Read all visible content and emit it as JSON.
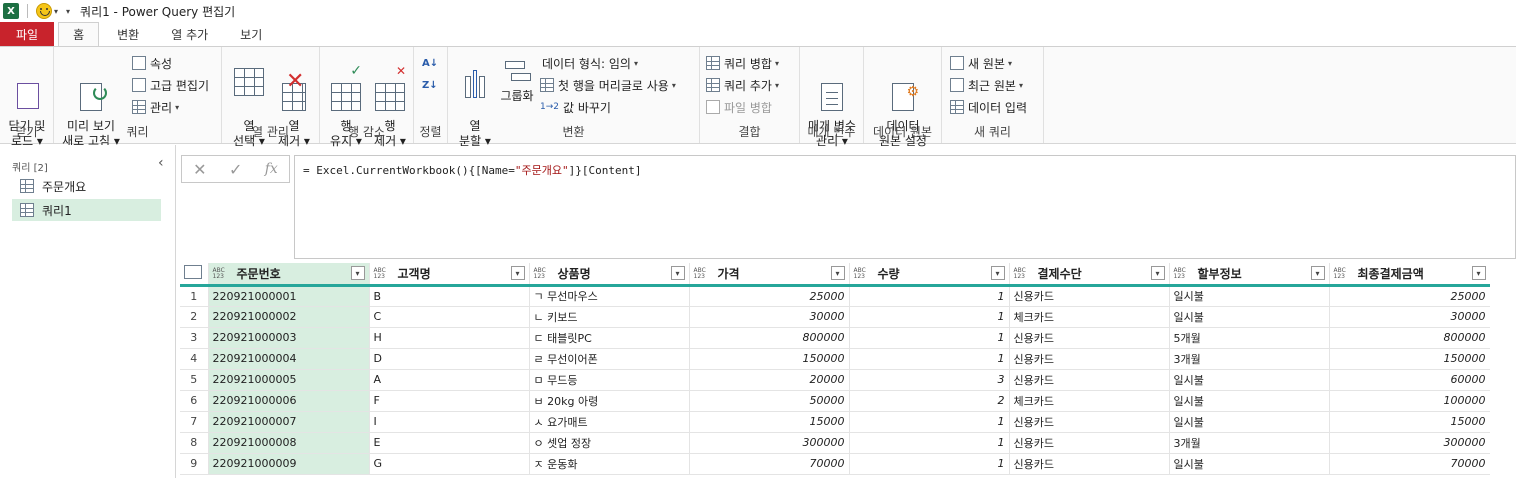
{
  "titlebar": {
    "app_icon": "X",
    "title": "쿼리1 - Power Query 편집기"
  },
  "tabs": [
    "파일",
    "홈",
    "변환",
    "열 추가",
    "보기"
  ],
  "ribbon": {
    "close": {
      "btn": "닫기 및\n로드 ▾",
      "group": "닫기"
    },
    "query": {
      "refresh": "미리 보기\n새로 고침 ▾",
      "properties": "속성",
      "advanced_editor": "고급 편집기",
      "manage": "관리",
      "group": "쿼리"
    },
    "columns": {
      "choose": "열\n선택 ▾",
      "remove": "열\n제거 ▾",
      "group": "열 관리"
    },
    "rows": {
      "keep": "행\n유지 ▾",
      "remove": "행\n제거 ▾",
      "group": "행 감소"
    },
    "sort": {
      "group": "정렬"
    },
    "transform": {
      "split": "열\n분할 ▾",
      "groupby": "그룹화",
      "data_type": "데이터 형식: 임의",
      "first_row_header": "첫 행을 머리글로 사용",
      "replace_values": "값 바꾸기",
      "group": "변환"
    },
    "combine": {
      "merge": "쿼리 병합",
      "append": "쿼리 추가",
      "combine_files": "파일 병합",
      "group": "결합"
    },
    "params": {
      "manage": "매개 변수\n관리 ▾",
      "group": "매개 변수"
    },
    "datasource": {
      "settings": "데이터\n원본 설정",
      "group": "데이터 원본"
    },
    "newquery": {
      "new_source": "새 원본",
      "recent_sources": "최근 원본",
      "enter_data": "데이터 입력",
      "group": "새 쿼리"
    }
  },
  "queries_pane": {
    "title": "쿼리 [2]",
    "items": [
      "주문개요",
      "쿼리1"
    ]
  },
  "formula": {
    "prefix": "= Excel.CurrentWorkbook(){[Name=",
    "string": "\"주문개요\"",
    "suffix": "]}[Content]"
  },
  "table": {
    "columns": [
      "주문번호",
      "고객명",
      "상품명",
      "가격",
      "수량",
      "결제수단",
      "할부정보",
      "최종결제금액"
    ],
    "rows": [
      [
        "1",
        "220921000001",
        "B",
        "ㄱ 무선마우스",
        "25000",
        "1",
        "신용카드",
        "일시불",
        "25000"
      ],
      [
        "2",
        "220921000002",
        "C",
        "ㄴ 키보드",
        "30000",
        "1",
        "체크카드",
        "일시불",
        "30000"
      ],
      [
        "3",
        "220921000003",
        "H",
        "ㄷ 태블릿PC",
        "800000",
        "1",
        "신용카드",
        "5개월",
        "800000"
      ],
      [
        "4",
        "220921000004",
        "D",
        "ㄹ 무선이어폰",
        "150000",
        "1",
        "신용카드",
        "3개월",
        "150000"
      ],
      [
        "5",
        "220921000005",
        "A",
        "ㅁ 무드등",
        "20000",
        "3",
        "신용카드",
        "일시불",
        "60000"
      ],
      [
        "6",
        "220921000006",
        "F",
        "ㅂ 20kg 아령",
        "50000",
        "2",
        "체크카드",
        "일시불",
        "100000"
      ],
      [
        "7",
        "220921000007",
        "I",
        "ㅅ 요가매트",
        "15000",
        "1",
        "신용카드",
        "일시불",
        "15000"
      ],
      [
        "8",
        "220921000008",
        "E",
        "ㅇ 셋업 정장",
        "300000",
        "1",
        "신용카드",
        "3개월",
        "300000"
      ],
      [
        "9",
        "220921000009",
        "G",
        "ㅈ 운동화",
        "70000",
        "1",
        "신용카드",
        "일시불",
        "70000"
      ]
    ]
  }
}
